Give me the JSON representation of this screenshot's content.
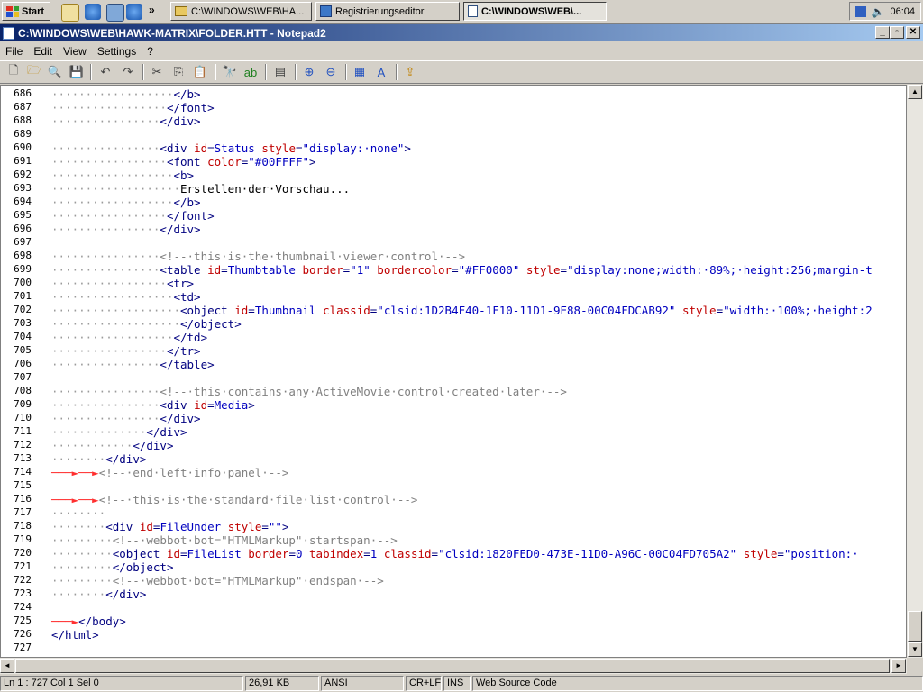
{
  "taskbar": {
    "start_label": "Start",
    "quick_launch_more": "»",
    "tasks": [
      {
        "label": "C:\\WINDOWS\\WEB\\HA..."
      },
      {
        "label": "Registrierungseditor"
      },
      {
        "label": "C:\\WINDOWS\\WEB\\..."
      }
    ],
    "clock": "06:04"
  },
  "window": {
    "title": "C:\\WINDOWS\\WEB\\HAWK-MATRIX\\FOLDER.HTT - Notepad2",
    "minimize": "_",
    "maximize": "▫",
    "close": "✕"
  },
  "menu": [
    "File",
    "Edit",
    "View",
    "Settings",
    "?"
  ],
  "editor": {
    "lines": [
      {
        "n": "686",
        "ws": "··················",
        "segs": [
          [
            "tag",
            "</b>"
          ]
        ]
      },
      {
        "n": "687",
        "ws": "·················",
        "segs": [
          [
            "tag",
            "</font>"
          ]
        ]
      },
      {
        "n": "688",
        "ws": "················",
        "segs": [
          [
            "tag",
            "</div>"
          ]
        ]
      },
      {
        "n": "689",
        "ws": "",
        "segs": []
      },
      {
        "n": "690",
        "ws": "················",
        "segs": [
          [
            "tag",
            "<div "
          ],
          [
            "attr",
            "id"
          ],
          [
            "tag",
            "="
          ],
          [
            "val",
            "Status "
          ],
          [
            "attr",
            "style"
          ],
          [
            "tag",
            "="
          ],
          [
            "val",
            "\"display:·none\""
          ],
          [
            "tag",
            ">"
          ]
        ]
      },
      {
        "n": "691",
        "ws": "·················",
        "segs": [
          [
            "tag",
            "<font "
          ],
          [
            "attr",
            "color"
          ],
          [
            "tag",
            "="
          ],
          [
            "val",
            "\"#00FFFF\""
          ],
          [
            "tag",
            ">"
          ]
        ]
      },
      {
        "n": "692",
        "ws": "··················",
        "segs": [
          [
            "tag",
            "<b>"
          ]
        ]
      },
      {
        "n": "693",
        "ws": "···················",
        "segs": [
          [
            "txt",
            "Erstellen·der·Vorschau..."
          ]
        ]
      },
      {
        "n": "694",
        "ws": "··················",
        "segs": [
          [
            "tag",
            "</b>"
          ]
        ]
      },
      {
        "n": "695",
        "ws": "·················",
        "segs": [
          [
            "tag",
            "</font>"
          ]
        ]
      },
      {
        "n": "696",
        "ws": "················",
        "segs": [
          [
            "tag",
            "</div>"
          ]
        ]
      },
      {
        "n": "697",
        "ws": "",
        "segs": []
      },
      {
        "n": "698",
        "ws": "················",
        "segs": [
          [
            "cmt",
            "<!--·this·is·the·thumbnail·viewer·control·-->"
          ]
        ]
      },
      {
        "n": "699",
        "ws": "················",
        "segs": [
          [
            "tag",
            "<table "
          ],
          [
            "attr",
            "id"
          ],
          [
            "tag",
            "="
          ],
          [
            "val",
            "Thumbtable "
          ],
          [
            "attr",
            "border"
          ],
          [
            "tag",
            "="
          ],
          [
            "val",
            "\"1\" "
          ],
          [
            "attr",
            "bordercolor"
          ],
          [
            "tag",
            "="
          ],
          [
            "val",
            "\"#FF0000\" "
          ],
          [
            "attr",
            "style"
          ],
          [
            "tag",
            "="
          ],
          [
            "val",
            "\"display:none;width:·89%;·height:256;margin-t"
          ]
        ]
      },
      {
        "n": "700",
        "ws": "·················",
        "segs": [
          [
            "tag",
            "<tr>"
          ]
        ]
      },
      {
        "n": "701",
        "ws": "··················",
        "segs": [
          [
            "tag",
            "<td>"
          ]
        ]
      },
      {
        "n": "702",
        "ws": "···················",
        "segs": [
          [
            "tag",
            "<object "
          ],
          [
            "attr",
            "id"
          ],
          [
            "tag",
            "="
          ],
          [
            "val",
            "Thumbnail "
          ],
          [
            "attr",
            "classid"
          ],
          [
            "tag",
            "="
          ],
          [
            "val",
            "\"clsid:1D2B4F40-1F10-11D1-9E88-00C04FDCAB92\" "
          ],
          [
            "attr",
            "style"
          ],
          [
            "tag",
            "="
          ],
          [
            "val",
            "\"width:·100%;·height:2"
          ]
        ]
      },
      {
        "n": "703",
        "ws": "···················",
        "segs": [
          [
            "tag",
            "</object>"
          ]
        ]
      },
      {
        "n": "704",
        "ws": "··················",
        "segs": [
          [
            "tag",
            "</td>"
          ]
        ]
      },
      {
        "n": "705",
        "ws": "·················",
        "segs": [
          [
            "tag",
            "</tr>"
          ]
        ]
      },
      {
        "n": "706",
        "ws": "················",
        "segs": [
          [
            "tag",
            "</table>"
          ]
        ]
      },
      {
        "n": "707",
        "ws": "",
        "segs": []
      },
      {
        "n": "708",
        "ws": "················",
        "segs": [
          [
            "cmt",
            "<!--·this·contains·any·ActiveMovie·control·created·later·-->"
          ]
        ]
      },
      {
        "n": "709",
        "ws": "················",
        "segs": [
          [
            "tag",
            "<div "
          ],
          [
            "attr",
            "id"
          ],
          [
            "tag",
            "="
          ],
          [
            "val",
            "Media"
          ],
          [
            "tag",
            ">"
          ]
        ]
      },
      {
        "n": "710",
        "ws": "················",
        "segs": [
          [
            "tag",
            "</div>"
          ]
        ]
      },
      {
        "n": "711",
        "ws": "··············",
        "segs": [
          [
            "tag",
            "</div>"
          ]
        ]
      },
      {
        "n": "712",
        "ws": "············",
        "segs": [
          [
            "tag",
            "</div>"
          ]
        ]
      },
      {
        "n": "713",
        "ws": "········",
        "segs": [
          [
            "tag",
            "</div>"
          ]
        ]
      },
      {
        "n": "714",
        "ws": "",
        "arrows": "───►──►",
        "segs": [
          [
            "cmt",
            "<!--·end·left·info·panel·-->"
          ]
        ]
      },
      {
        "n": "715",
        "ws": "",
        "segs": []
      },
      {
        "n": "716",
        "ws": "",
        "arrows": "───►──►",
        "segs": [
          [
            "cmt",
            "<!--·this·is·the·standard·file·list·control·-->"
          ]
        ]
      },
      {
        "n": "717",
        "ws": "········",
        "segs": []
      },
      {
        "n": "718",
        "ws": "········",
        "segs": [
          [
            "tag",
            "<div "
          ],
          [
            "attr",
            "id"
          ],
          [
            "tag",
            "="
          ],
          [
            "val",
            "FileUnder "
          ],
          [
            "attr",
            "style"
          ],
          [
            "tag",
            "="
          ],
          [
            "val",
            "\"\""
          ],
          [
            "tag",
            ">"
          ]
        ]
      },
      {
        "n": "719",
        "ws": "·········",
        "segs": [
          [
            "cmt",
            "<!--·webbot·bot=\"HTMLMarkup\"·startspan·-->"
          ]
        ]
      },
      {
        "n": "720",
        "ws": "·········",
        "segs": [
          [
            "tag",
            "<object "
          ],
          [
            "attr",
            "id"
          ],
          [
            "tag",
            "="
          ],
          [
            "val",
            "FileList "
          ],
          [
            "attr",
            "border"
          ],
          [
            "tag",
            "="
          ],
          [
            "val",
            "0 "
          ],
          [
            "attr",
            "tabindex"
          ],
          [
            "tag",
            "="
          ],
          [
            "val",
            "1 "
          ],
          [
            "attr",
            "classid"
          ],
          [
            "tag",
            "="
          ],
          [
            "val",
            "\"clsid:1820FED0-473E-11D0-A96C-00C04FD705A2\" "
          ],
          [
            "attr",
            "style"
          ],
          [
            "tag",
            "="
          ],
          [
            "val",
            "\"position:·"
          ]
        ]
      },
      {
        "n": "721",
        "ws": "·········",
        "segs": [
          [
            "tag",
            "</object>"
          ]
        ]
      },
      {
        "n": "722",
        "ws": "·········",
        "segs": [
          [
            "cmt",
            "<!--·webbot·bot=\"HTMLMarkup\"·endspan·-->"
          ]
        ]
      },
      {
        "n": "723",
        "ws": "········",
        "segs": [
          [
            "tag",
            "</div>"
          ]
        ]
      },
      {
        "n": "724",
        "ws": "",
        "segs": []
      },
      {
        "n": "725",
        "ws": "",
        "arrows": "───►",
        "segs": [
          [
            "tag",
            "</body>"
          ]
        ]
      },
      {
        "n": "726",
        "ws": "",
        "segs": [
          [
            "tag",
            "</html>"
          ]
        ]
      },
      {
        "n": "727",
        "ws": "",
        "segs": []
      }
    ]
  },
  "status": {
    "position": "Ln 1 : 727   Col 1   Sel 0",
    "size": "26,91 KB",
    "encoding": "ANSI",
    "eol": "CR+LF",
    "mode": "INS",
    "scheme": "Web Source Code"
  }
}
